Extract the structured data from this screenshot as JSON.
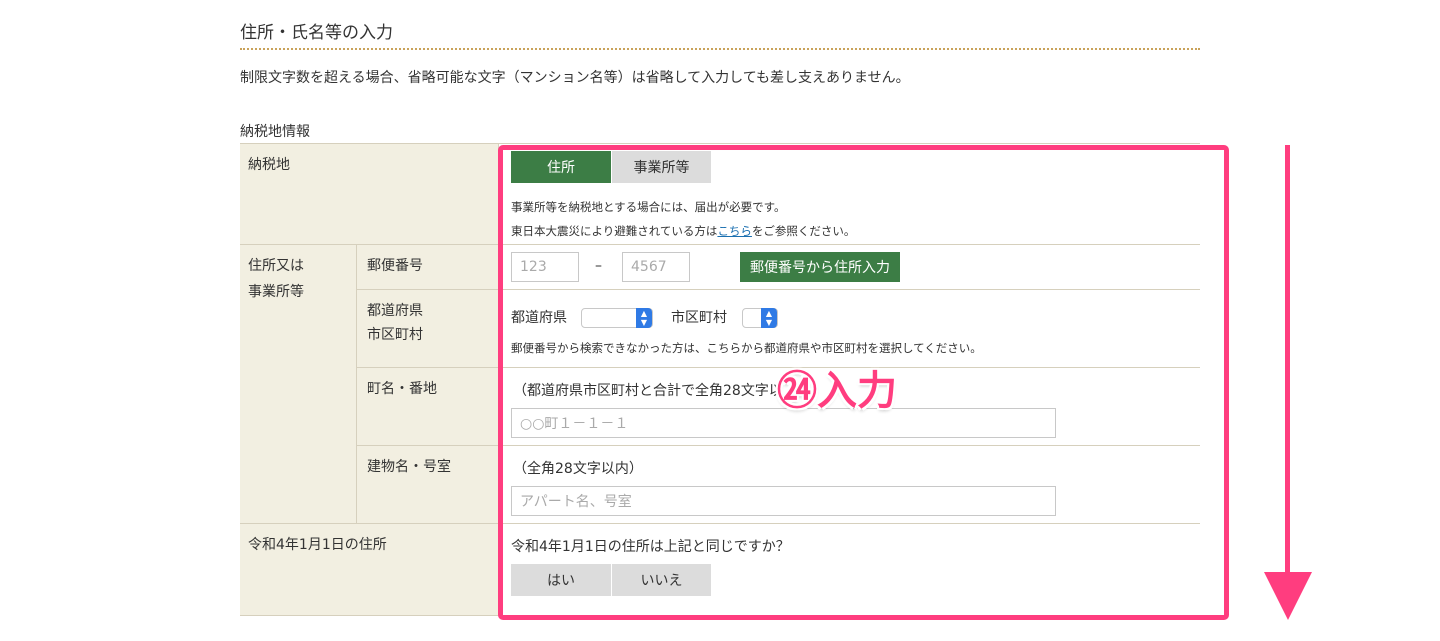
{
  "section_title": "住所・氏名等の入力",
  "notice": "制限文字数を超える場合、省略可能な文字（マンション名等）は省略して入力しても差し支えありません。",
  "subhead": "納税地情報",
  "rows": {
    "nozeichi": {
      "label": "納税地",
      "options": [
        "住所",
        "事業所等"
      ],
      "note1": "事業所等を納税地とする場合には、届出が必要です。",
      "note2_pre": "東日本大震災により避難されている方は",
      "note2_link": "こちら",
      "note2_post": "をご参照ください。"
    },
    "address_group_label_1": "住所又は",
    "address_group_label_2": "事業所等",
    "postal": {
      "label": "郵便番号",
      "placeholder1": "123",
      "dash": "–",
      "placeholder2": "4567",
      "button": "郵便番号から住所入力"
    },
    "pref": {
      "label_1": "都道府県",
      "label_2": "市区町村",
      "pref_label": "都道府県",
      "city_label": "市区町村",
      "note": "郵便番号から検索できなかった方は、こちらから都道府県や市区町村を選択してください。"
    },
    "town": {
      "label": "町名・番地",
      "hint": "（都道府県市区町村と合計で全角28文字以",
      "placeholder": "○○町１－１－１"
    },
    "building": {
      "label": "建物名・号室",
      "hint": "（全角28文字以内）",
      "placeholder": "アパート名、号室"
    },
    "r4": {
      "label": "令和4年1月1日の住所",
      "question": "令和4年1月1日の住所は上記と同じですか？",
      "yes": "はい",
      "no": "いいえ"
    }
  },
  "annotation": {
    "callout": "㉔入力",
    "color": "#ff3d7f"
  },
  "colors": {
    "accent_green": "#3c7d45",
    "header_bg": "#f2efe1",
    "link": "#1a6fb0"
  }
}
